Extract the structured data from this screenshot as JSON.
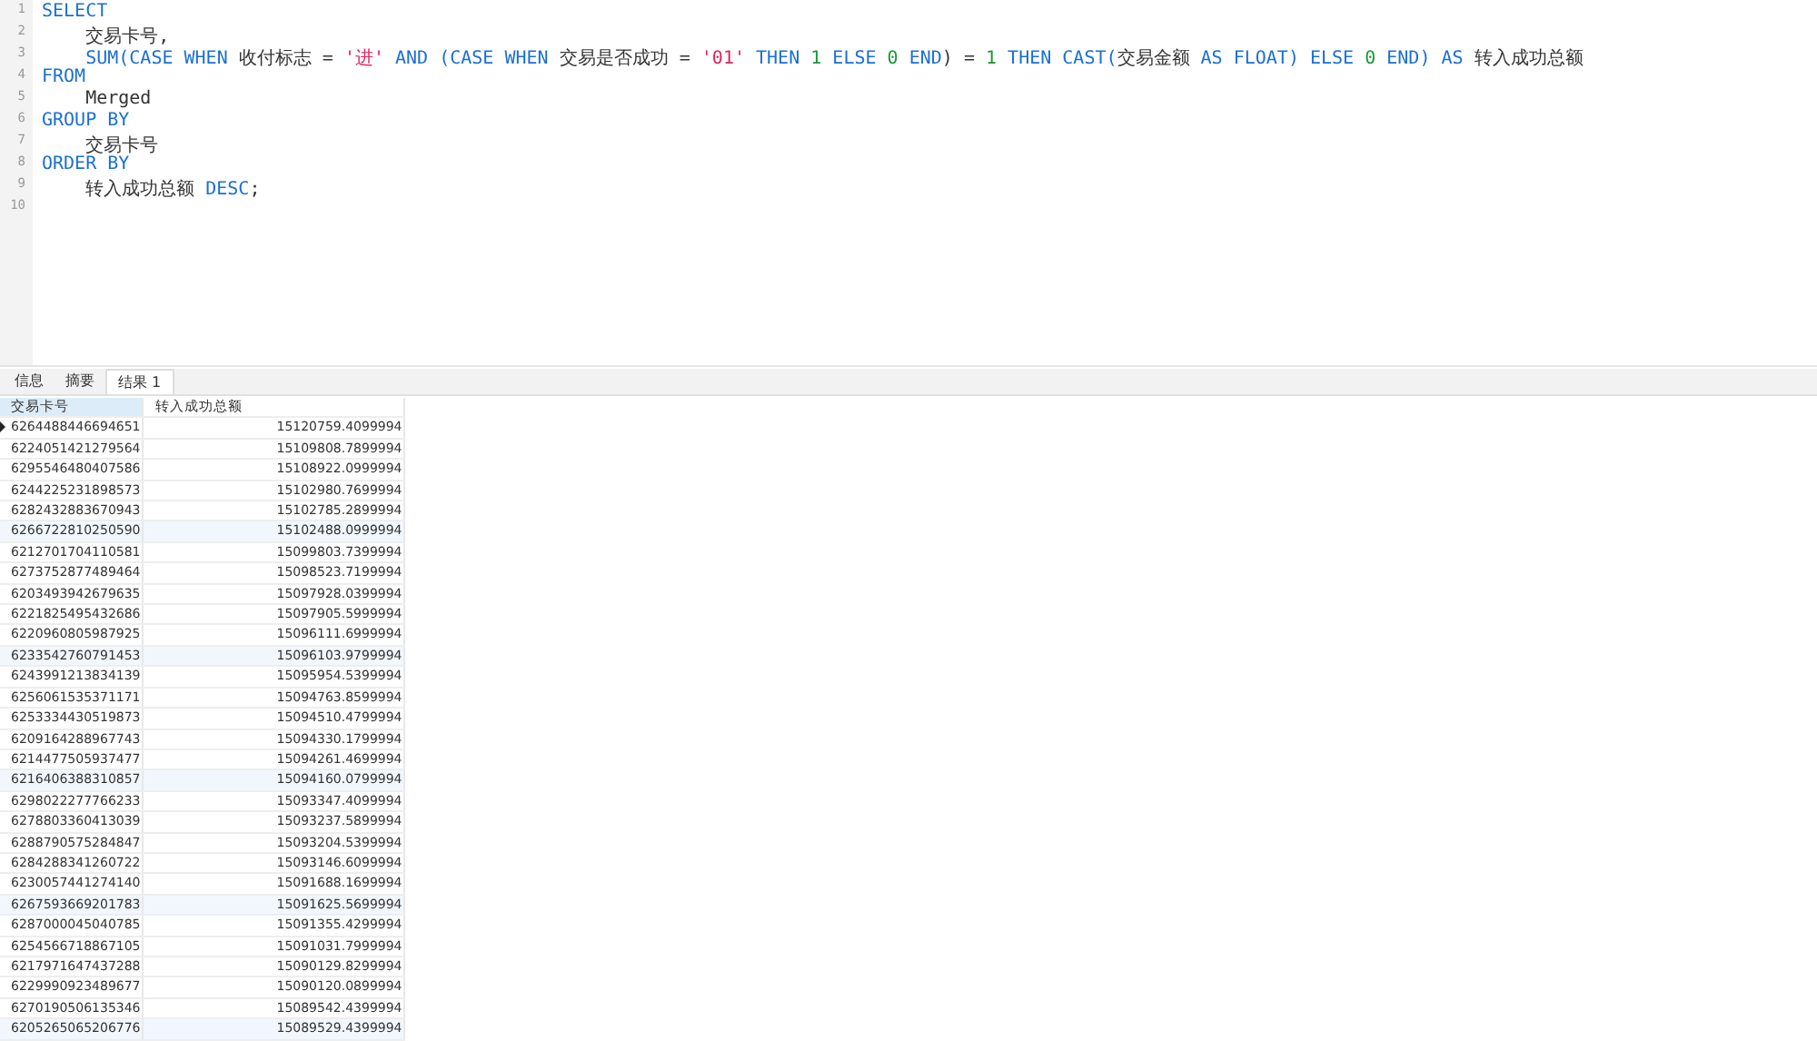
{
  "editor": {
    "lines": [
      {
        "number": "1",
        "tokens": [
          {
            "text": "SELECT",
            "kind": "keyword"
          }
        ]
      },
      {
        "number": "2",
        "tokens": [
          {
            "text": "    交易卡号,",
            "kind": "plain"
          }
        ]
      },
      {
        "number": "3",
        "tokens": [
          {
            "text": "    SUM(CASE WHEN",
            "kind": "keyword"
          },
          {
            "text": " 收付标志 = ",
            "kind": "plain"
          },
          {
            "text": "'进'",
            "kind": "string"
          },
          {
            "text": " AND (CASE WHEN",
            "kind": "keyword"
          },
          {
            "text": " 交易是否成功 = ",
            "kind": "plain"
          },
          {
            "text": "'01'",
            "kind": "string"
          },
          {
            "text": " THEN ",
            "kind": "keyword"
          },
          {
            "text": "1",
            "kind": "number"
          },
          {
            "text": " ELSE ",
            "kind": "keyword"
          },
          {
            "text": "0",
            "kind": "number"
          },
          {
            "text": " END",
            "kind": "keyword"
          },
          {
            "text": ") = ",
            "kind": "plain"
          },
          {
            "text": "1",
            "kind": "number"
          },
          {
            "text": " THEN CAST(",
            "kind": "keyword"
          },
          {
            "text": "交易金额",
            "kind": "plain"
          },
          {
            "text": " AS FLOAT) ELSE ",
            "kind": "keyword"
          },
          {
            "text": "0",
            "kind": "number"
          },
          {
            "text": " END) AS",
            "kind": "keyword"
          },
          {
            "text": " 转入成功总额",
            "kind": "plain"
          }
        ]
      },
      {
        "number": "4",
        "tokens": [
          {
            "text": "FROM",
            "kind": "keyword"
          }
        ]
      },
      {
        "number": "5",
        "tokens": [
          {
            "text": "    Merged",
            "kind": "plain"
          }
        ]
      },
      {
        "number": "6",
        "tokens": [
          {
            "text": "GROUP BY",
            "kind": "keyword"
          }
        ]
      },
      {
        "number": "7",
        "tokens": [
          {
            "text": "    交易卡号",
            "kind": "plain"
          }
        ]
      },
      {
        "number": "8",
        "tokens": [
          {
            "text": "ORDER BY",
            "kind": "keyword"
          }
        ]
      },
      {
        "number": "9",
        "tokens": [
          {
            "text": "    转入成功总额 ",
            "kind": "plain"
          },
          {
            "text": "DESC",
            "kind": "keyword"
          },
          {
            "text": ";",
            "kind": "plain"
          }
        ]
      },
      {
        "number": "10"
      }
    ]
  },
  "tabs": [
    {
      "label": "信息",
      "selected": false
    },
    {
      "label": "摘要",
      "selected": false
    },
    {
      "label": "结果 1",
      "selected": true
    }
  ],
  "table": {
    "columns": [
      "交易卡号",
      "转入成功总额"
    ],
    "rows": [
      {
        "cells": [
          "6264488446694651",
          "15120759.4099994"
        ],
        "selected": true
      },
      {
        "cells": [
          "6224051421279564",
          "15109808.7899994"
        ],
        "selected": false
      },
      {
        "cells": [
          "6295546480407586",
          "15108922.0999994"
        ],
        "selected": false
      },
      {
        "cells": [
          "6244225231898573",
          "15102980.7699994"
        ],
        "selected": false
      },
      {
        "cells": [
          "6282432883670943",
          "15102785.2899994"
        ],
        "selected": false
      },
      {
        "cells": [
          "6266722810250590",
          "15102488.0999994"
        ],
        "selected": false
      },
      {
        "cells": [
          "6212701704110581",
          "15099803.7399994"
        ],
        "selected": false
      },
      {
        "cells": [
          "6273752877489464",
          "15098523.7199994"
        ],
        "selected": false
      },
      {
        "cells": [
          "6203493942679635",
          "15097928.0399994"
        ],
        "selected": false
      },
      {
        "cells": [
          "6221825495432686",
          "15097905.5999994"
        ],
        "selected": false
      },
      {
        "cells": [
          "6220960805987925",
          "15096111.6999994"
        ],
        "selected": false
      },
      {
        "cells": [
          "6233542760791453",
          "15096103.9799994"
        ],
        "selected": false
      },
      {
        "cells": [
          "6243991213834139",
          "15095954.5399994"
        ],
        "selected": false
      },
      {
        "cells": [
          "6256061535371171",
          "15094763.8599994"
        ],
        "selected": false
      },
      {
        "cells": [
          "6253334430519873",
          "15094510.4799994"
        ],
        "selected": false
      },
      {
        "cells": [
          "6209164288967743",
          "15094330.1799994"
        ],
        "selected": false
      },
      {
        "cells": [
          "6214477505937477",
          "15094261.4699994"
        ],
        "selected": false
      },
      {
        "cells": [
          "6216406388310857",
          "15094160.0799994"
        ],
        "selected": false
      },
      {
        "cells": [
          "6298022277766233",
          "15093347.4099994"
        ],
        "selected": false
      },
      {
        "cells": [
          "6278803360413039",
          "15093237.5899994"
        ],
        "selected": false
      },
      {
        "cells": [
          "6288790575284847",
          "15093204.5399994"
        ],
        "selected": false
      },
      {
        "cells": [
          "6284288341260722",
          "15093146.6099994"
        ],
        "selected": false
      },
      {
        "cells": [
          "6230057441274140",
          "15091688.1699994"
        ],
        "selected": false
      },
      {
        "cells": [
          "6267593669201783",
          "15091625.5699994"
        ],
        "selected": false
      },
      {
        "cells": [
          "6287000045040785",
          "15091355.4299994"
        ],
        "selected": false
      },
      {
        "cells": [
          "6254566718867105",
          "15091031.7999994"
        ],
        "selected": false
      },
      {
        "cells": [
          "6217971647437288",
          "15090129.8299994"
        ],
        "selected": false
      },
      {
        "cells": [
          "6229990923489677",
          "15090120.0899994"
        ],
        "selected": false
      },
      {
        "cells": [
          "6270190506135346",
          "15089542.4399994"
        ],
        "selected": false
      },
      {
        "cells": [
          "6205265065206776",
          "15089529.4399994"
        ],
        "selected": false
      }
    ]
  }
}
